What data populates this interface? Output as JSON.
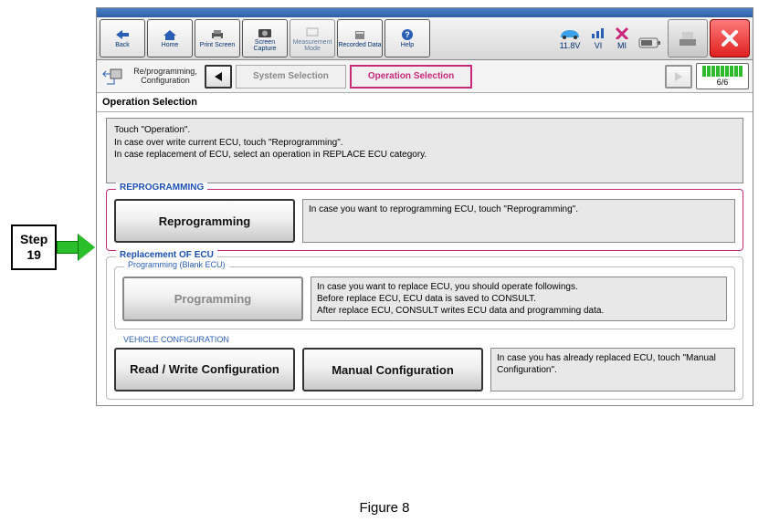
{
  "toolbar": {
    "back": "Back",
    "home": "Home",
    "print": "Print Screen",
    "capture": "Screen Capture",
    "measure": "Measurement Mode",
    "recorded": "Recorded Data",
    "help": "Help"
  },
  "status": {
    "voltage": "11.8V",
    "vi": "VI",
    "mi": "MI"
  },
  "breadcrumb": {
    "label": "Re/programming, Configuration",
    "step_prev": "System Selection",
    "step_current": "Operation Selection",
    "progress": "6/6"
  },
  "page": {
    "title": "Operation Selection",
    "instructions_l1": "Touch \"Operation\".",
    "instructions_l2": "In case over write current ECU, touch \"Reprogramming\".",
    "instructions_l3": "In case replacement of ECU, select an operation in REPLACE ECU category."
  },
  "reprogramming": {
    "legend": "REPROGRAMMING",
    "button": "Reprogramming",
    "desc": "In case you want to reprogramming ECU, touch \"Reprogramming\"."
  },
  "replacement": {
    "legend": "Replacement OF ECU",
    "prog_legend": "Programming (Blank ECU)",
    "prog_button": "Programming",
    "prog_desc": "In case you want to replace ECU, you should operate followings.\nBefore replace ECU, ECU data is saved to CONSULT.\nAfter replace ECU, CONSULT writes ECU data and programming data.",
    "vc_legend": "VEHICLE CONFIGURATION",
    "readwrite_button": "Read / Write Configuration",
    "manual_button": "Manual Configuration",
    "vc_desc": "In case you has already replaced ECU, touch \"Manual Configuration\"."
  },
  "callout": {
    "line1": "Step",
    "line2": "19"
  },
  "figure_caption": "Figure 8"
}
